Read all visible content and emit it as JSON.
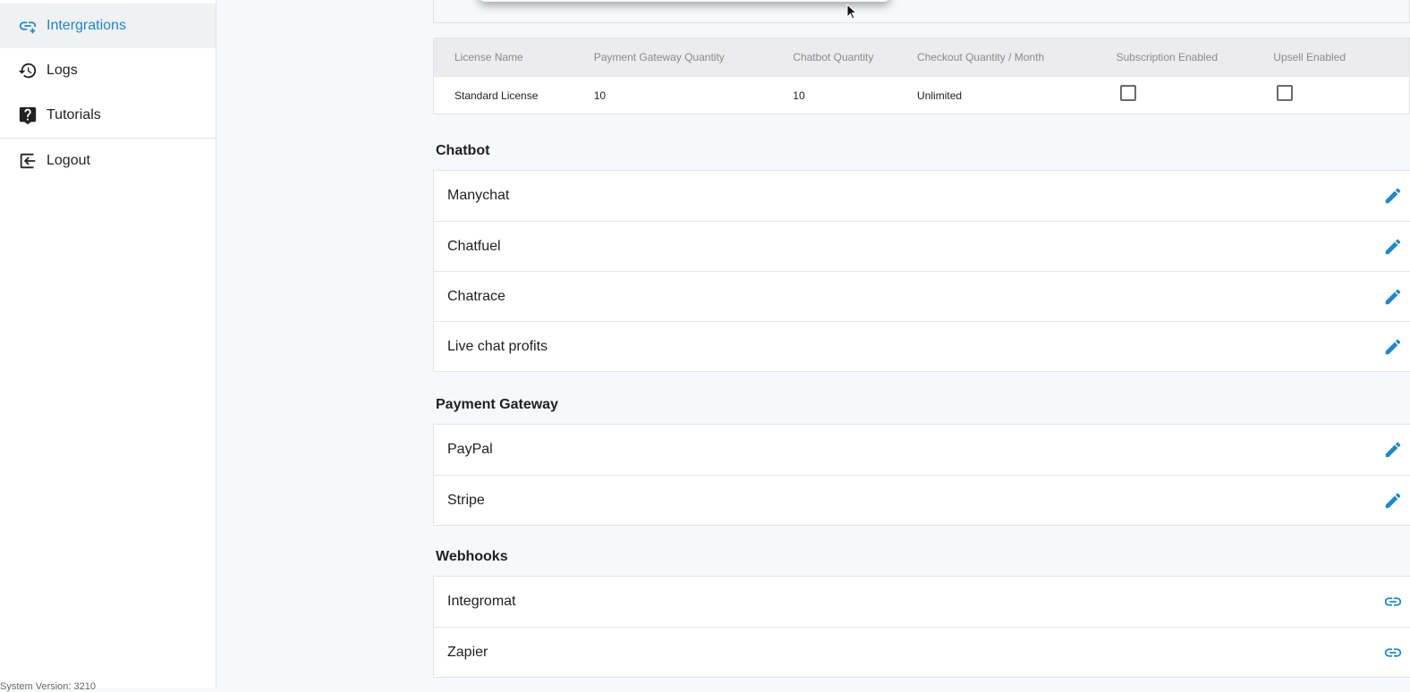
{
  "colors": {
    "accent": "#1e88c9",
    "text": "#1f1f1f",
    "muted": "#8a8a8a"
  },
  "sidebar": {
    "items": [
      {
        "label": "Intergrations",
        "icon": "link-plus-icon",
        "active": true
      },
      {
        "label": "Logs",
        "icon": "history-icon"
      },
      {
        "label": "Tutorials",
        "icon": "help-chat-icon"
      },
      {
        "label": "Logout",
        "icon": "logout-icon"
      }
    ],
    "version": "System Version: 3210"
  },
  "license": {
    "headers": [
      "License Name",
      "Payment Gateway Quantity",
      "Chatbot Quantity",
      "Checkout Quantity / Month",
      "Subscription Enabled",
      "Upsell Enabled"
    ],
    "row": {
      "name": "Standard License",
      "payment_gateway_qty": "10",
      "chatbot_qty": "10",
      "checkout_qty": "Unlimited"
    }
  },
  "sections": {
    "chatbot": {
      "title": "Chatbot",
      "items": [
        "Manychat",
        "Chatfuel",
        "Chatrace",
        "Live chat profits"
      ]
    },
    "payment": {
      "title": "Payment Gateway",
      "items": [
        "PayPal",
        "Stripe"
      ]
    },
    "webhooks": {
      "title": "Webhooks",
      "items": [
        "Integromat",
        "Zapier"
      ]
    }
  }
}
